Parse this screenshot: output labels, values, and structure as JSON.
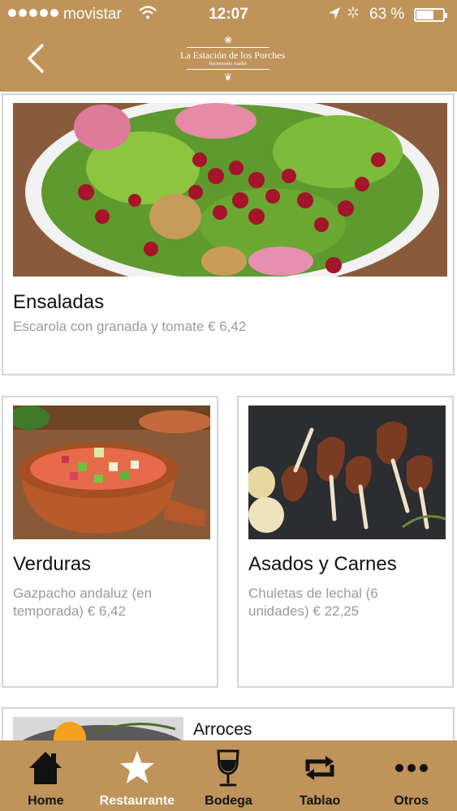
{
  "status_bar": {
    "carrier": "movistar",
    "time": "12:07",
    "battery": "63 %"
  },
  "header": {
    "logo_name": "La Estación de los Porches",
    "logo_sub": "Restaurante Asador",
    "back_icon": "chevron-left-icon"
  },
  "menu_sections": [
    {
      "title": "Ensaladas",
      "description": "Escarola con granada y tomate € 6,42"
    },
    {
      "title": "Verduras",
      "description": "Gazpacho andaluz (en temporada) € 6,42"
    },
    {
      "title": "Asados y Carnes",
      "description": "Chuletas de lechal (6 unidades) € 22,25"
    },
    {
      "title": "Arroces"
    }
  ],
  "tab_bar": {
    "tabs": [
      {
        "label": "Home",
        "icon": "home-icon",
        "active": false
      },
      {
        "label": "Restaurante",
        "icon": "star-icon",
        "active": true
      },
      {
        "label": "Bodega",
        "icon": "wine-glass-icon",
        "active": false
      },
      {
        "label": "Tablao",
        "icon": "repeat-icon",
        "active": false
      },
      {
        "label": "Otros",
        "icon": "more-icon",
        "active": false
      }
    ]
  },
  "colors": {
    "brand": "#bf9359",
    "active_tab_label": "#ffffff",
    "inactive_tab": "#111111",
    "description_text": "#9a9a9a"
  }
}
